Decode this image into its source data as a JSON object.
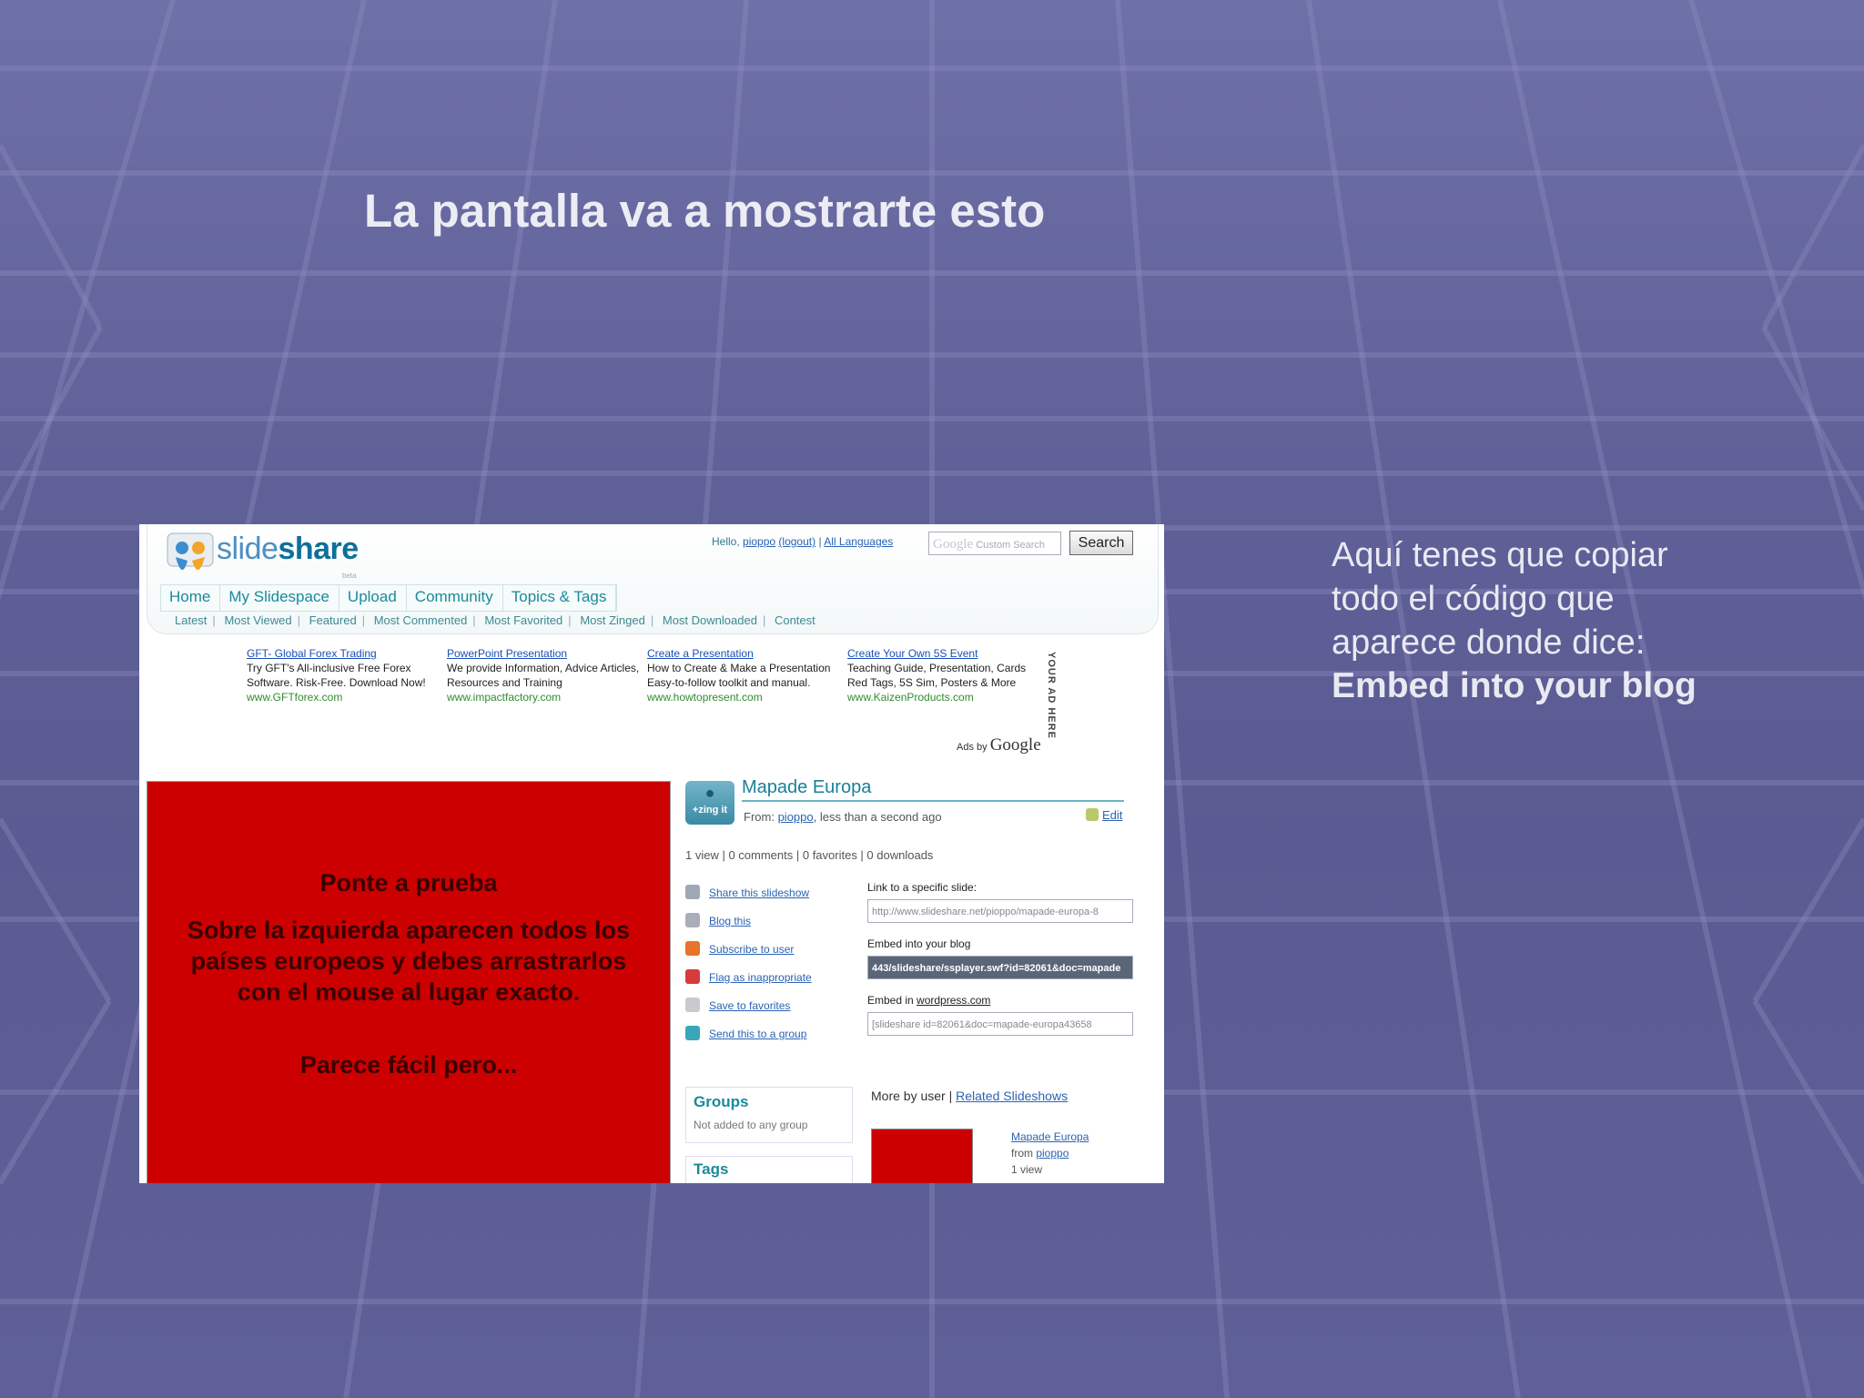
{
  "slide": {
    "title": "La pantalla va a mostrarte esto",
    "note_lines": [
      "Aquí tenes que copiar todo el código que aparece donde dice:"
    ],
    "note_emphasis": "Embed into your blog"
  },
  "screenshot": {
    "logo": {
      "name": "slideshare-logo-icon",
      "text_light": "slide",
      "text_bold": "share",
      "badge": "beta"
    },
    "top_links": {
      "hello": "Hello,",
      "user": "pioppo",
      "logout": "(logout)",
      "sep": "|",
      "languages": "All Languages"
    },
    "search": {
      "placeholder_brand": "Google",
      "placeholder_text": "Custom Search",
      "button": "Search"
    },
    "nav": [
      "Home",
      "My Slidespace",
      "Upload",
      "Community",
      "Topics & Tags"
    ],
    "subnav": [
      "Latest",
      "Most Viewed",
      "Featured",
      "Most Commented",
      "Most Favorited",
      "Most Zinged",
      "Most Downloaded",
      "Contest"
    ],
    "ads": [
      {
        "title": "GFT- Global Forex Trading",
        "body": "Try GFT's All-inclusive Free Forex Software. Risk-Free. Download Now!",
        "url": "www.GFTforex.com"
      },
      {
        "title": "PowerPoint Presentation",
        "body": "We provide Information, Advice Articles, Resources and Training",
        "url": "www.impactfactory.com"
      },
      {
        "title": "Create a Presentation",
        "body": "How to Create & Make a Presentation Easy-to-follow toolkit and manual.",
        "url": "www.howtopresent.com"
      },
      {
        "title": "Create Your Own 5S Event",
        "body": "Teaching Guide, Presentation, Cards Red Tags, 5S Sim, Posters & More",
        "url": "www.KaizenProducts.com"
      }
    ],
    "your_ad_here": "YOUR AD HERE",
    "ads_by": "Ads by",
    "ads_by_brand": "Google",
    "red_slide": {
      "heading": "Ponte a prueba",
      "paragraph": "Sobre la izquierda aparecen todos los países europeos y debes arrastrarlos con el mouse al lugar exacto.",
      "closing": "Parece fácil pero..."
    },
    "presentation": {
      "zing_label": "+zing it",
      "title": "Mapade Europa",
      "from_label": "From:",
      "from_user": "pioppo",
      "time": "less than a second ago",
      "edit": "Edit",
      "stats": "1 view  |  0 comments  |  0 favorites  |  0 downloads"
    },
    "actions": [
      {
        "icon": "share-icon",
        "label": "Share this slideshow",
        "color": "#9fa8b4"
      },
      {
        "icon": "blog-icon",
        "label": "Blog this",
        "color": "#a9aeb8"
      },
      {
        "icon": "rss-icon",
        "label": "Subscribe to user",
        "color": "#e8732a"
      },
      {
        "icon": "flag-icon",
        "label": "Flag as inappropriate",
        "color": "#d83b3b"
      },
      {
        "icon": "heart-icon",
        "label": "Save to favorites",
        "color": "#c9c9d0"
      },
      {
        "icon": "group-icon",
        "label": "Send this to a group",
        "color": "#39a7b8"
      }
    ],
    "embeds": {
      "link_label": "Link to a specific slide:",
      "link_value": "http://www.slideshare.net/pioppo/mapade-europa-8",
      "embed_label": "Embed into your blog",
      "embed_value": "443/slideshare/ssplayer.swf?id=82061&doc=mapade",
      "wp_label": "Embed in",
      "wp_link": "wordpress.com",
      "wp_value": "[slideshare id=82061&doc=mapade-europa43658"
    },
    "groups": {
      "title": "Groups",
      "subtitle": "Not added to any group"
    },
    "tags": {
      "title": "Tags"
    },
    "more": {
      "by_user": "More by user",
      "sep": "|",
      "related": "Related Slideshows"
    },
    "related_item": {
      "title": "Mapade Europa",
      "from_label": "from",
      "from_user": "pioppo",
      "views": "1 view"
    }
  }
}
